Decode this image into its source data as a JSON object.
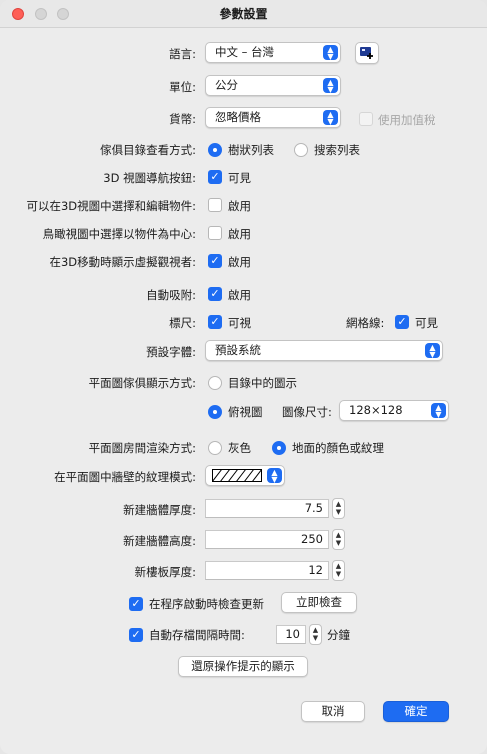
{
  "window": {
    "title": "參數設置"
  },
  "language": {
    "label": "語言:",
    "value": "中文 – 台灣"
  },
  "unit": {
    "label": "單位:",
    "value": "公分"
  },
  "currency": {
    "label": "貨幣:",
    "value": "忽略價格",
    "vat_label": "使用加值稅"
  },
  "catalog_view": {
    "label": "傢俱目錄查看方式:",
    "option_tree": "樹狀列表",
    "option_search": "搜索列表"
  },
  "nav_arrows": {
    "label": "3D 視圖導航按鈕:",
    "value": "可見"
  },
  "select_edit_3d": {
    "label": "可以在3D視圖中選擇和編輯物件:",
    "value": "啟用"
  },
  "aerial_center": {
    "label": "鳥瞰視圖中選擇以物件為中心:",
    "value": "啟用"
  },
  "virtual_visitor": {
    "label": "在3D移動時顯示虛擬觀視者:",
    "value": "啟用"
  },
  "magnetism": {
    "label": "自動吸附:",
    "value": "啟用"
  },
  "rulers": {
    "label": "標尺:",
    "value": "可視"
  },
  "grid": {
    "label": "網格線:",
    "value": "可見"
  },
  "default_font": {
    "label": "預設字體:",
    "value": "預設系統"
  },
  "furniture_icon": {
    "label": "平面圖傢俱顯示方式:",
    "option_catalog": "目錄中的圖示",
    "option_top": "俯視圖",
    "size_label": "圖像尺寸:",
    "size_value": "128×128"
  },
  "room_render": {
    "label": "平面圖房間渲染方式:",
    "option_color": "灰色",
    "option_floor": "地面的顏色或紋理"
  },
  "wall_pattern": {
    "label": "在平面圖中牆壁的紋理模式:"
  },
  "wall_thickness": {
    "label": "新建牆體厚度:",
    "value": "7.5"
  },
  "wall_height": {
    "label": "新建牆體高度:",
    "value": "250"
  },
  "floor_thickness": {
    "label": "新樓板厚度:",
    "value": "12"
  },
  "updates": {
    "label": "在程序啟動時檢查更新",
    "button": "立即檢查"
  },
  "autosave": {
    "label": "自動存檔間隔時間:",
    "value": "10",
    "unit": "分鐘"
  },
  "reset_tips": {
    "button": "還原操作提示的顯示"
  },
  "footer": {
    "cancel": "取消",
    "ok": "確定"
  },
  "colors": {
    "accent": "#1e6cf2",
    "close": "#fe5f57"
  }
}
